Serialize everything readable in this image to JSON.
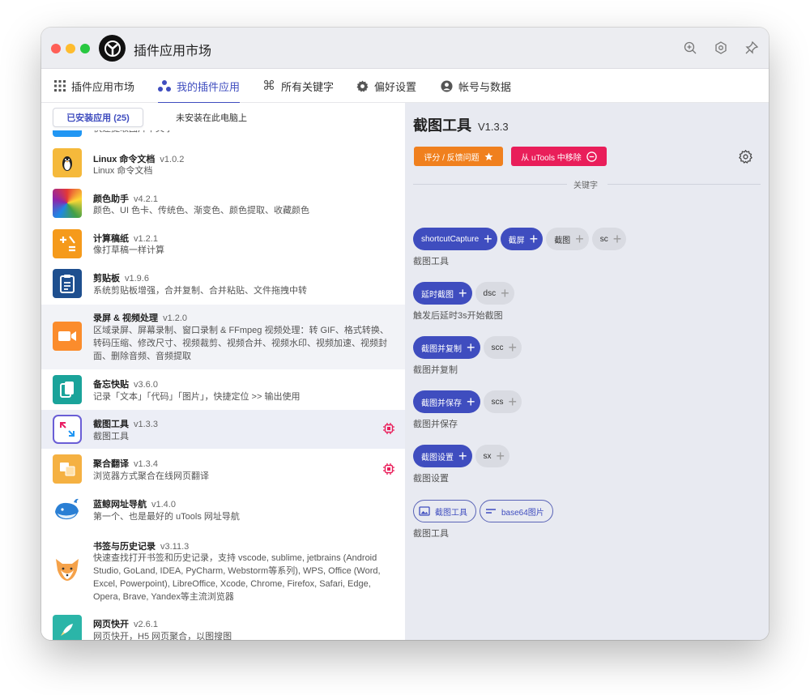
{
  "window": {
    "title": "插件应用市场"
  },
  "titlebar": {
    "icons": [
      "search-zoom-icon",
      "settings-hex-icon",
      "pin-icon"
    ]
  },
  "nav": {
    "tabs": [
      {
        "label": "插件应用市场",
        "icon": "grid-icon"
      },
      {
        "label": "我的插件应用",
        "icon": "plugins-icon",
        "active": true
      },
      {
        "label": "所有关键字",
        "icon": "command-icon"
      },
      {
        "label": "偏好设置",
        "icon": "gear-icon"
      },
      {
        "label": "帐号与数据",
        "icon": "user-icon"
      }
    ]
  },
  "subtabs": {
    "installed": "已安装应用 (25)",
    "not_installed": "未安装在此电脑上"
  },
  "plugins": [
    {
      "name": "",
      "version": "",
      "desc": "快速提取图片中文字",
      "color": "#2196f3"
    },
    {
      "name": "Linux 命令文档",
      "version": "v1.0.2",
      "desc": "Linux 命令文档",
      "color": "#f5b93b"
    },
    {
      "name": "颜色助手",
      "version": "v4.2.1",
      "desc": "颜色、UI 色卡、传统色、渐变色、颜色提取、收藏颜色",
      "color": "#e53935"
    },
    {
      "name": "计算稿纸",
      "version": "v1.2.1",
      "desc": "像打草稿一样计算",
      "color": "#f59a1b"
    },
    {
      "name": "剪贴板",
      "version": "v1.9.6",
      "desc": "系统剪贴板增强，合并复制、合并粘贴、文件拖拽中转",
      "color": "#1e4f8f"
    },
    {
      "name": "录屏 & 视频处理",
      "version": "v1.2.0",
      "desc": "区域录屏、屏幕录制、窗口录制 & FFmpeg 视频处理：转 GIF、格式转换、转码压缩、修改尺寸、视频裁剪、视频合并、视频水印、视频加速、视频封面、删除音频、音频提取",
      "color": "#fb8c2c"
    },
    {
      "name": "备忘快贴",
      "version": "v3.6.0",
      "desc": "记录「文本」「代码」「图片」，快捷定位 >> 输出使用",
      "color": "#1aa39a"
    },
    {
      "name": "截图工具",
      "version": "v1.3.3",
      "desc": "截图工具",
      "color": "#ffffff"
    },
    {
      "name": "聚合翻译",
      "version": "v1.3.4",
      "desc": "浏览器方式聚合在线网页翻译",
      "color": "#f5b142"
    },
    {
      "name": "蓝鲸网址导航",
      "version": "v1.4.0",
      "desc": "第一个、也是最好的 uTools 网址导航",
      "color": "#ffffff"
    },
    {
      "name": "书签与历史记录",
      "version": "v3.11.3",
      "desc": "快速查找打开书签和历史记录，支持 vscode, sublime, jetbrains (Android Studio, GoLand, IDEA, PyCharm, Webstorm等系列), WPS, Office (Word, Excel, Powerpoint), LibreOffice, Xcode, Chrome, Firefox, Safari, Edge, Opera, Brave, Yandex等主流浏览器",
      "color": "#ffffff"
    },
    {
      "name": "网页快开",
      "version": "v2.6.1",
      "desc": "网页快开，H5 网页聚合，以图搜图",
      "color": "#2bb5a8"
    }
  ],
  "detail": {
    "title": "截图工具",
    "version": "V1.3.3",
    "feedback_label": "评分 / 反馈问题",
    "remove_label": "从 uTools 中移除",
    "keywords_label": "关键字",
    "features": [
      {
        "keywords": [
          "shortcutCapture",
          "截屏",
          "截图",
          "sc"
        ],
        "desc": "截图工具"
      },
      {
        "keywords": [
          "延时截图",
          "dsc"
        ],
        "desc": "触发后延时3s开始截图"
      },
      {
        "keywords": [
          "截图并复制",
          "scc"
        ],
        "desc": "截图并复制"
      },
      {
        "keywords": [
          "截图并保存",
          "scs"
        ],
        "desc": "截图并保存"
      },
      {
        "keywords": [
          "截图设置",
          "sx"
        ],
        "desc": "截图设置"
      },
      {
        "keywords": [
          "截图工具",
          "base64图片"
        ],
        "desc": "截图工具"
      }
    ]
  },
  "colors": {
    "accent": "#3f4dbf",
    "orange": "#f0801e",
    "pink": "#e91e5a"
  }
}
